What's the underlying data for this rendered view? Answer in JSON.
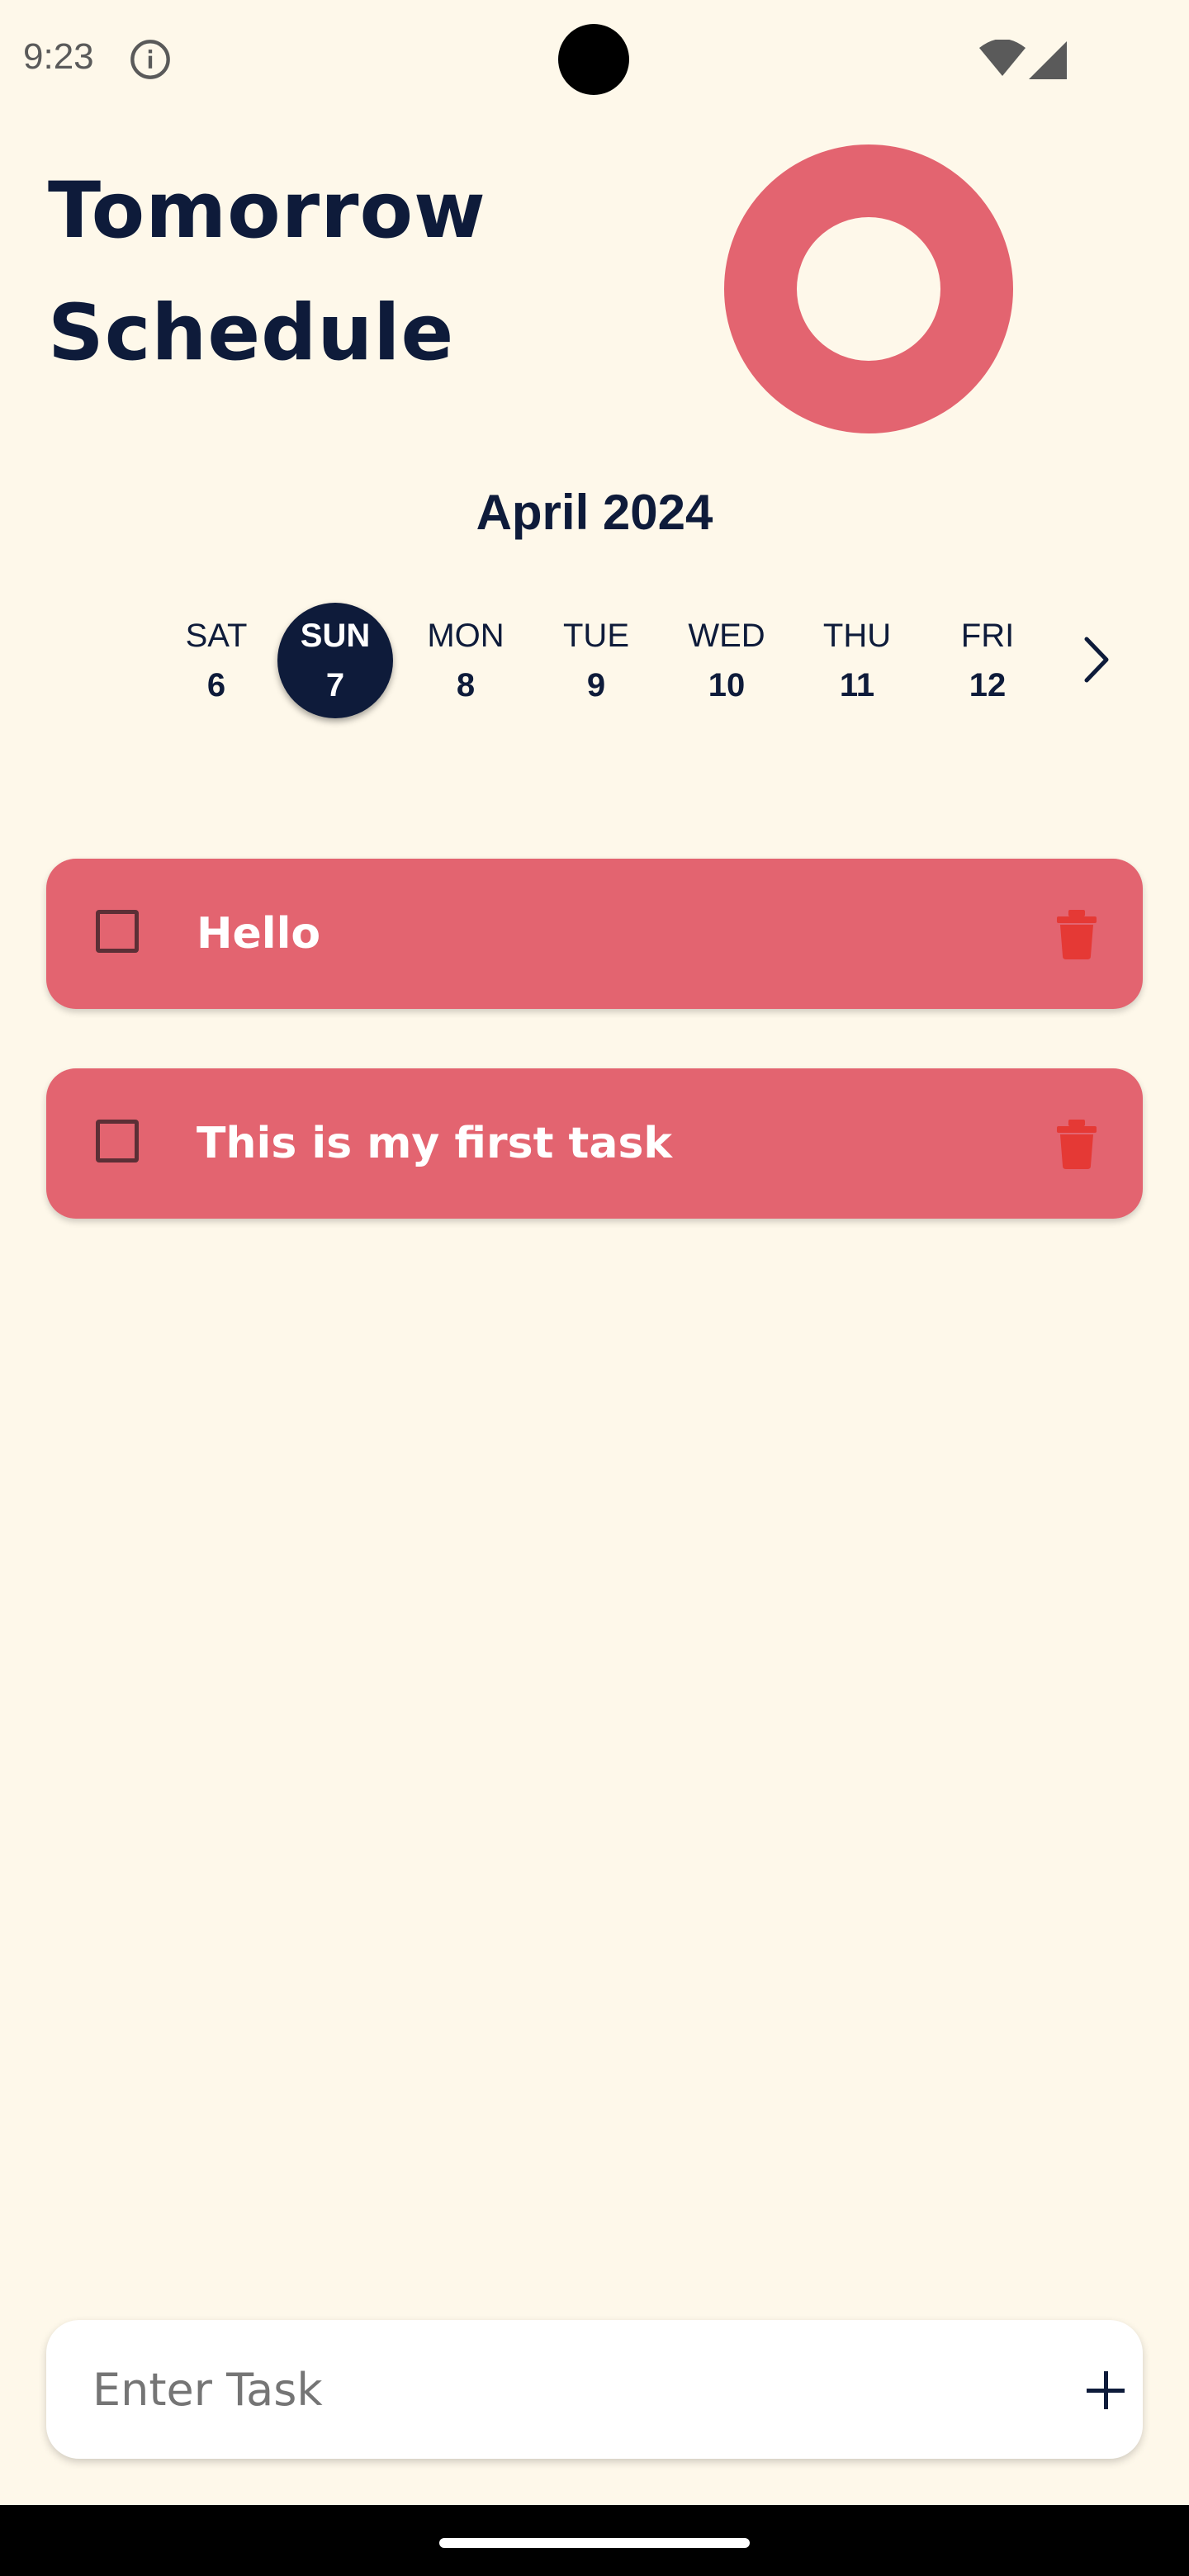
{
  "status_bar": {
    "time": "9:23",
    "icons": [
      "info-icon",
      "wifi-icon",
      "cell-signal-icon"
    ]
  },
  "header": {
    "title_line1": "Tomorrow",
    "title_line2": "Schedule",
    "progress_ring_color": "#E36470"
  },
  "calendar": {
    "month": "April 2024",
    "days": [
      {
        "dow": "SAT",
        "num": "6"
      },
      {
        "dow": "SUN",
        "num": "7"
      },
      {
        "dow": "MON",
        "num": "8"
      },
      {
        "dow": "TUE",
        "num": "9"
      },
      {
        "dow": "WED",
        "num": "10"
      },
      {
        "dow": "THU",
        "num": "11"
      },
      {
        "dow": "FRI",
        "num": "12"
      }
    ],
    "selected_day": "SUN 7"
  },
  "tasks": [
    {
      "label": "Hello",
      "checked": false
    },
    {
      "label": "This is my first task",
      "checked": false
    }
  ],
  "input": {
    "placeholder": "Enter Task",
    "value": ""
  },
  "colors": {
    "background": "#FEF8EA",
    "primary_dark": "#0E1B3A",
    "task_card": "#E36470",
    "trash": "#E53935"
  }
}
